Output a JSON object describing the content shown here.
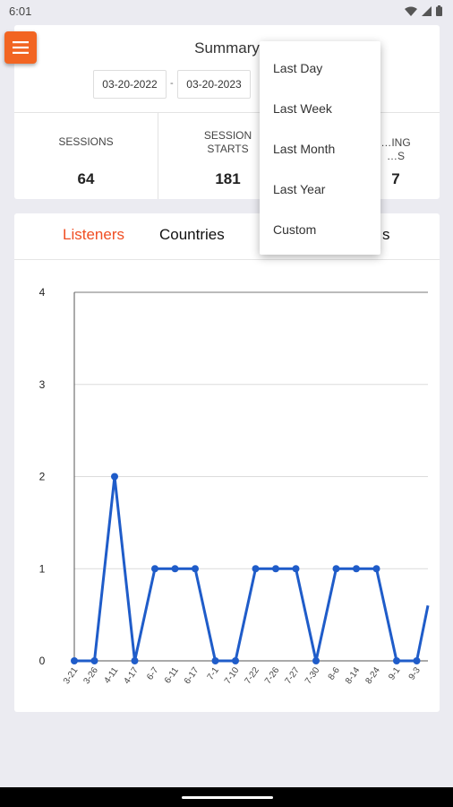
{
  "status_bar": {
    "time": "6:01",
    "icons": [
      "wifi-icon",
      "signal-icon",
      "battery-icon"
    ]
  },
  "menu_button": {
    "icon": "hamburger-menu-icon",
    "color": "#f26522"
  },
  "summary": {
    "title": "Summary",
    "date_from": "03-20-2022",
    "date_separator": "-",
    "date_to": "03-20-2023",
    "stats": [
      {
        "label_lines": [
          "SESSIONS"
        ],
        "value": "64"
      },
      {
        "label_lines": [
          "SESSION",
          "STARTS"
        ],
        "value": "181"
      },
      {
        "label_lines": [
          "…ING",
          "…S"
        ],
        "value": "7"
      }
    ]
  },
  "tabs": [
    {
      "label": "Listeners",
      "active": true
    },
    {
      "label": "Countries",
      "active": false
    },
    {
      "label": "s",
      "active": false
    }
  ],
  "dropdown": {
    "items": [
      "Last Day",
      "Last Week",
      "Last Month",
      "Last Year",
      "Custom"
    ]
  },
  "chart_data": {
    "type": "line",
    "categories": [
      "3-21",
      "3-26",
      "4-11",
      "4-17",
      "6-7",
      "6-11",
      "6-17",
      "7-1",
      "7-10",
      "7-22",
      "7-26",
      "7-27",
      "7-30",
      "8-6",
      "8-14",
      "8-24",
      "9-1",
      "9-3"
    ],
    "series": [
      {
        "values": [
          0,
          0,
          2,
          0,
          1,
          1,
          1,
          0,
          0,
          1,
          1,
          1,
          0,
          1,
          1,
          1,
          0,
          0,
          0.6
        ]
      }
    ],
    "y_ticks": [
      "0",
      "1",
      "2",
      "3",
      "4"
    ],
    "ylim": [
      0,
      4
    ],
    "grid": true,
    "color": "#1f5cc9"
  },
  "colors": {
    "accent": "#f04e23",
    "background": "#ebebf1",
    "line": "#1f5cc9"
  }
}
